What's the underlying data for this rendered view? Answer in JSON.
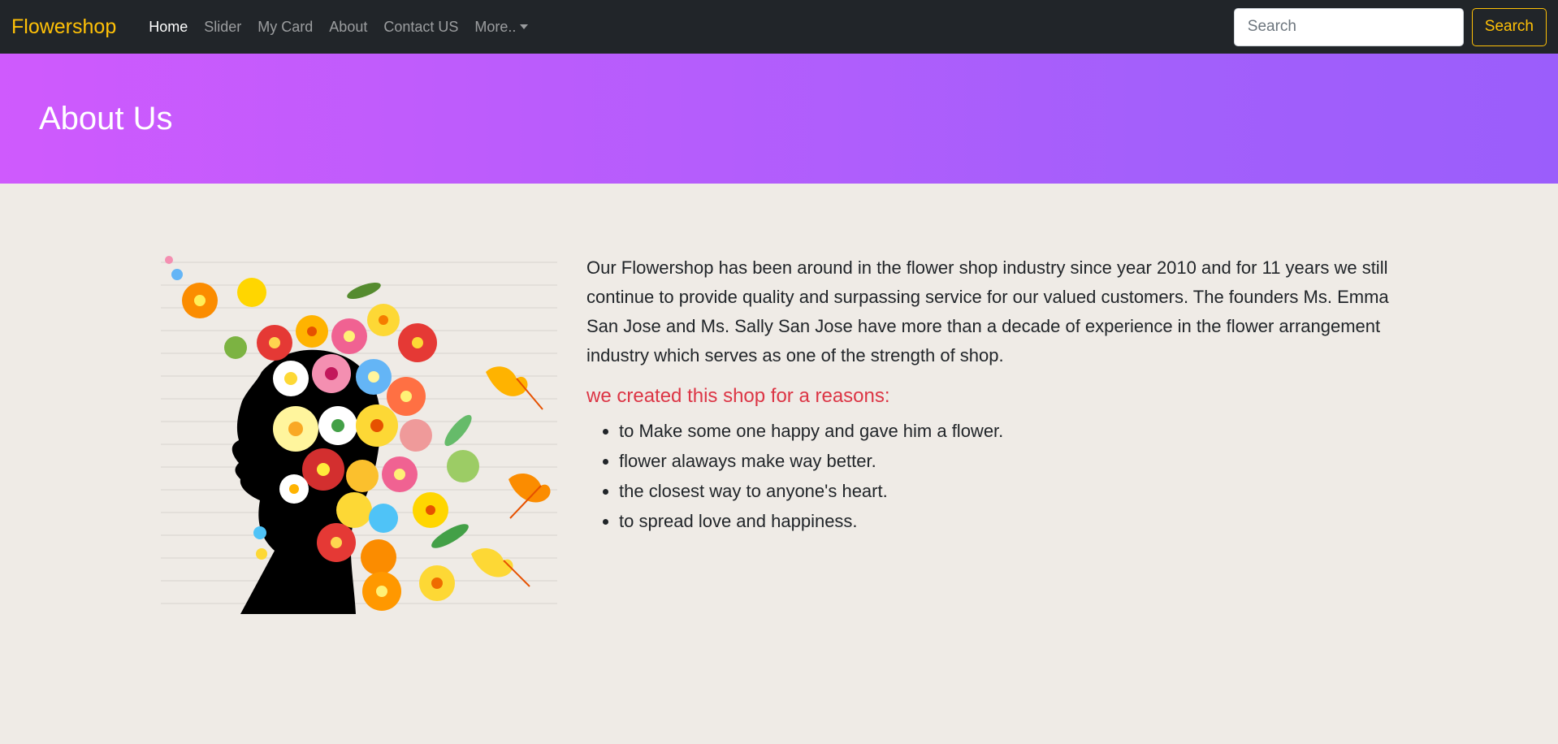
{
  "navbar": {
    "brand": "Flowershop",
    "links": [
      "Home",
      "Slider",
      "My Card",
      "About",
      "Contact US",
      "More.."
    ],
    "search_placeholder": "Search",
    "search_button": "Search"
  },
  "hero": {
    "title": "About Us"
  },
  "about": {
    "image_icon": "woman-flower-hair-illustration",
    "paragraph": "Our Flowershop has been around in the flower shop industry since year 2010 and for 11 years we still continue to provide quality and surpassing service for our valued customers. The founders Ms. Emma San Jose and Ms. Sally San Jose have more than a decade of experience in the flower arrangement industry which serves as one of the strength of shop.",
    "reasons_title": "we created this shop for a reasons:",
    "reasons": [
      "to Make some one happy and gave him a flower.",
      "flower alaways make way better.",
      "the closest way to anyone's heart.",
      "to spread love and happiness."
    ]
  },
  "colors": {
    "brand": "#ffc107",
    "navbar_bg": "#212529",
    "hero_gradient_start": "#cf5afd",
    "hero_gradient_end": "#9b5dfb",
    "page_bg": "#efebe6",
    "reasons_title": "#dc3545"
  }
}
